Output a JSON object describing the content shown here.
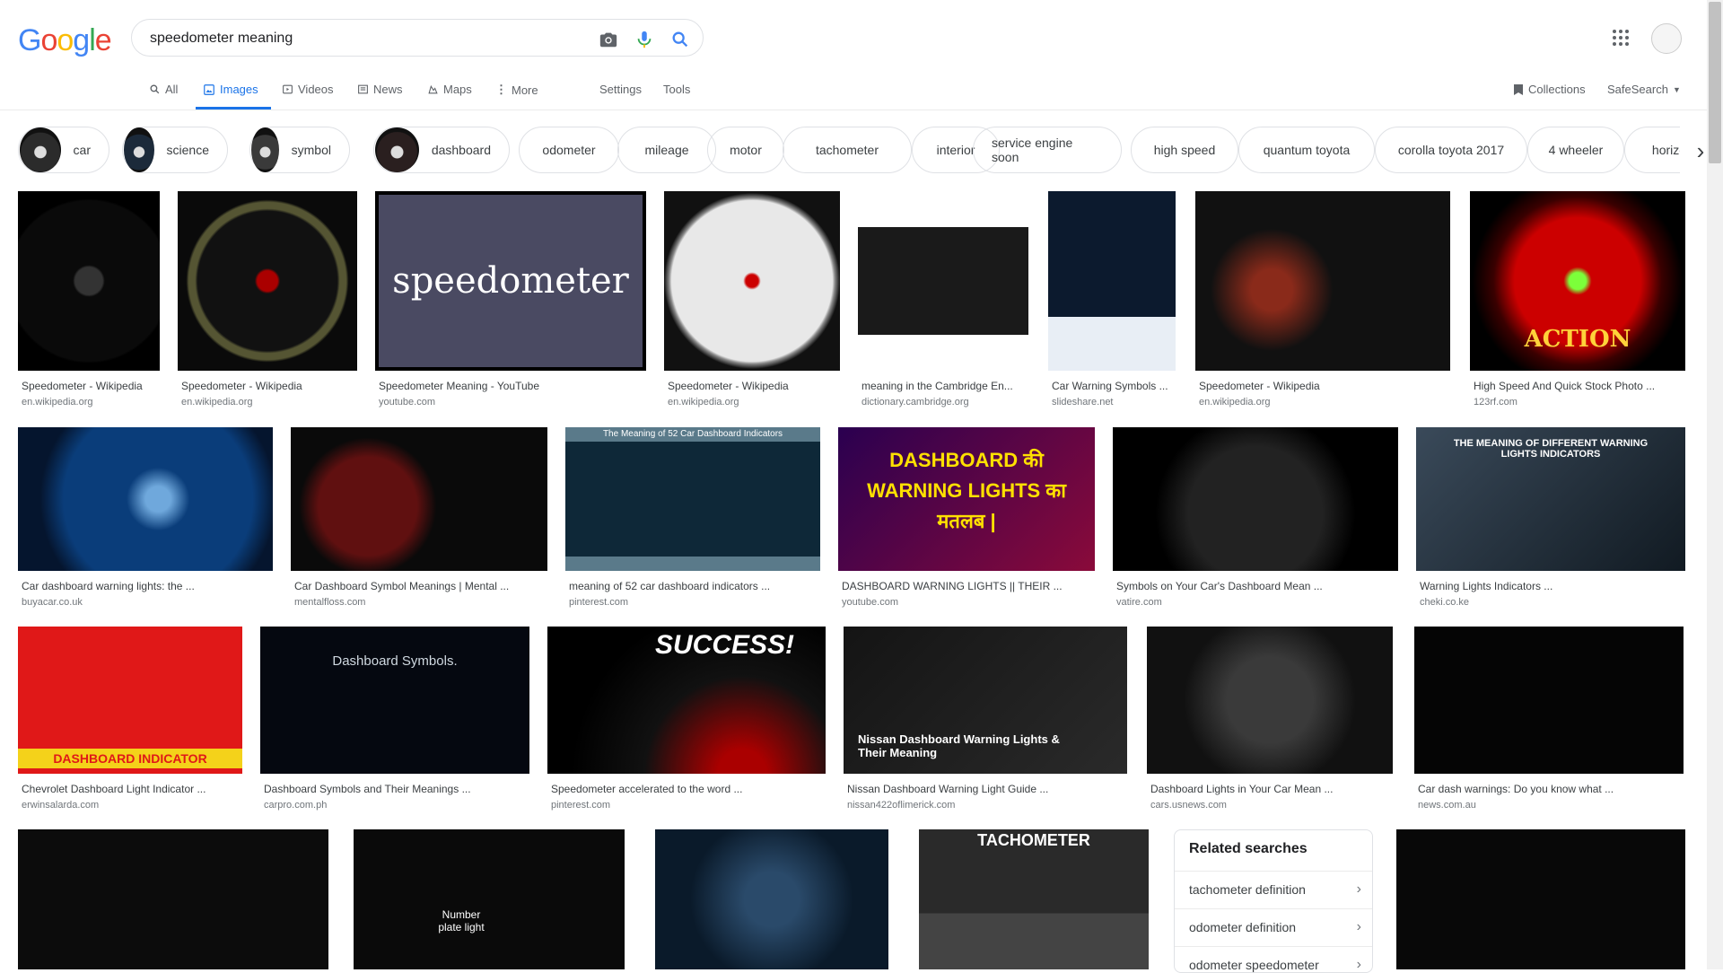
{
  "logo": {
    "letters": [
      "G",
      "o",
      "o",
      "g",
      "l",
      "e"
    ],
    "colors": [
      "#4285F4",
      "#EA4335",
      "#FBBC05",
      "#4285F4",
      "#34A853",
      "#EA4335"
    ]
  },
  "search": {
    "query": "speedometer meaning"
  },
  "nav": {
    "tabs": [
      {
        "label": "All",
        "icon": "search-icon"
      },
      {
        "label": "Images",
        "icon": "image-icon",
        "active": true
      },
      {
        "label": "Videos",
        "icon": "video-icon"
      },
      {
        "label": "News",
        "icon": "news-icon"
      },
      {
        "label": "Maps",
        "icon": "map-icon"
      },
      {
        "label": "More",
        "icon": "more-vertical-icon"
      }
    ],
    "settings": "Settings",
    "tools": "Tools",
    "collections": "Collections",
    "safesearch": "SafeSearch"
  },
  "chips": [
    {
      "label": "car",
      "thumb": true
    },
    {
      "label": "science",
      "thumb": true
    },
    {
      "label": "symbol",
      "thumb": true
    },
    {
      "label": "dashboard",
      "thumb": true
    },
    {
      "label": "odometer"
    },
    {
      "label": "mileage"
    },
    {
      "label": "motor"
    },
    {
      "label": "tachometer"
    },
    {
      "label": "interior"
    },
    {
      "label": "service engine soon"
    },
    {
      "label": "high speed"
    },
    {
      "label": "quantum toyota"
    },
    {
      "label": "corolla toyota 2017"
    },
    {
      "label": "4 wheeler"
    },
    {
      "label": "horizo"
    }
  ],
  "results": [
    {
      "caption": "Speedometer - Wikipedia",
      "source": "en.wikipedia.org"
    },
    {
      "caption": "Speedometer - Wikipedia",
      "source": "en.wikipedia.org"
    },
    {
      "caption": "Speedometer Meaning - YouTube",
      "source": "youtube.com",
      "overlay": "speedometer"
    },
    {
      "caption": "Speedometer - Wikipedia",
      "source": "en.wikipedia.org"
    },
    {
      "caption": "meaning in the Cambridge En...",
      "source": "dictionary.cambridge.org"
    },
    {
      "caption": "Car Warning Symbols ...",
      "source": "slideshare.net"
    },
    {
      "caption": "Speedometer - Wikipedia",
      "source": "en.wikipedia.org"
    },
    {
      "caption": "High Speed And Quick Stock Photo ...",
      "source": "123rf.com",
      "overlay": "ACTION"
    },
    {
      "caption": "Car dashboard warning lights: the ...",
      "source": "buyacar.co.uk"
    },
    {
      "caption": "Car Dashboard Symbol Meanings | Mental ...",
      "source": "mentalfloss.com"
    },
    {
      "caption": "meaning of 52 car dashboard indicators ...",
      "source": "pinterest.com",
      "overlay": "The Meaning of 52 Car Dashboard Indicators"
    },
    {
      "caption": "DASHBOARD WARNING LIGHTS || THEIR ...",
      "source": "youtube.com",
      "overlay": "DASHBOARD की WARNING LIGHTS का मतलब |"
    },
    {
      "caption": "Symbols on Your Car's Dashboard Mean ...",
      "source": "vatire.com"
    },
    {
      "caption": "Warning Lights Indicators ...",
      "source": "cheki.co.ke",
      "overlay": "THE MEANING OF DIFFERENT WARNING LIGHTS INDICATORS"
    },
    {
      "caption": "Chevrolet Dashboard Light Indicator ...",
      "source": "erwinsalarda.com",
      "overlay": "DASHBOARD INDICATOR"
    },
    {
      "caption": "Dashboard Symbols and Their Meanings ...",
      "source": "carpro.com.ph",
      "overlay": "Dashboard Symbols."
    },
    {
      "caption": "Speedometer accelerated to the word ...",
      "source": "pinterest.com",
      "overlay": "SUCCESS!"
    },
    {
      "caption": "Nissan Dashboard Warning Light Guide ...",
      "source": "nissan422oflimerick.com",
      "overlay": "Nissan Dashboard Warning Lights & Their Meaning"
    },
    {
      "caption": "Dashboard Lights in Your Car Mean ...",
      "source": "cars.usnews.com"
    },
    {
      "caption": "Car dash warnings: Do you know what ...",
      "source": "news.com.au"
    },
    {
      "caption": "",
      "source": ""
    },
    {
      "caption": "",
      "source": "",
      "overlay": "Number plate light"
    },
    {
      "caption": "",
      "source": ""
    },
    {
      "caption": "",
      "source": "",
      "overlay": "TACHOMETER"
    },
    {
      "caption": "",
      "source": ""
    }
  ],
  "related": {
    "title": "Related searches",
    "items": [
      "tachometer definition",
      "odometer definition",
      "odometer speedometer"
    ]
  }
}
